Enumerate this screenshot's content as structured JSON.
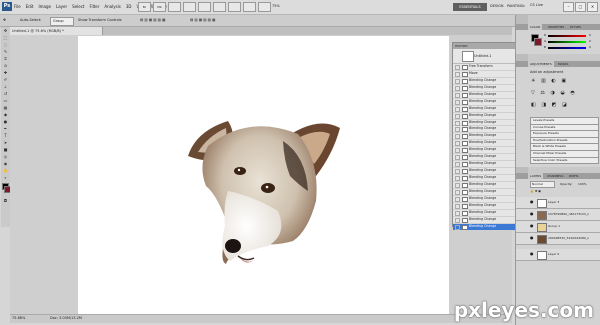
{
  "app": {
    "logo": "Ps"
  },
  "menu": [
    "File",
    "Edit",
    "Image",
    "Layer",
    "Select",
    "Filter",
    "Analysis",
    "3D",
    "View",
    "Window",
    "Help"
  ],
  "toolbar_buttons": [
    "Br",
    "Mb",
    "",
    "",
    "",
    "",
    "",
    "",
    ""
  ],
  "zoom_value": "75%",
  "workspace": {
    "active": "ESSENTIALS",
    "others": [
      "DESIGN",
      "PAINTING"
    ],
    "more": "»"
  },
  "cs_live": "CS Live",
  "window_controls": [
    "–",
    "□",
    "✕"
  ],
  "options": {
    "auto_select": "Auto-Select:",
    "auto_select_value": "Group",
    "show_transform": "Show Transform Controls"
  },
  "document": {
    "tab": "Untitled-1 @ 75.6% (RGB/8) *",
    "status_zoom": "75.68%",
    "status_doc": "Doc: 3.00M/13.2M"
  },
  "history": {
    "panel_title": "HISTORY",
    "snapshot": "Untitled-1",
    "states": [
      "Free Transform",
      "Move",
      "Blending Change",
      "Blending Change",
      "Blending Change",
      "Blending Change",
      "Blending Change",
      "Blending Change",
      "Blending Change",
      "Blending Change",
      "Blending Change",
      "Blending Change",
      "Blending Change",
      "Blending Change",
      "Blending Change",
      "Blending Change",
      "Blending Change",
      "Blending Change",
      "Blending Change",
      "Blending Change",
      "Blending Change",
      "Blending Change",
      "Blending Change",
      "Blending Change"
    ]
  },
  "color_panel": {
    "tabs": [
      "COLOR",
      "SWATCHES",
      "STYLES"
    ],
    "sliders": [
      {
        "label": "R",
        "value": "0"
      },
      {
        "label": "G",
        "value": "0"
      },
      {
        "label": "B",
        "value": "0"
      }
    ]
  },
  "adjustments": {
    "tabs": [
      "ADJUSTMENTS",
      "MASKS"
    ],
    "heading": "Add an adjustment",
    "presets": [
      "Levels Presets",
      "Curves Presets",
      "Exposure Presets",
      "Hue/Saturation Presets",
      "Black & White Presets",
      "Channel Mixer Presets",
      "Selective Color Presets"
    ]
  },
  "layers": {
    "tabs": [
      "LAYERS",
      "CHANNELS",
      "PATHS"
    ],
    "blend_mode": "Normal",
    "opacity_label": "Opacity:",
    "opacity_value": "100%",
    "items": [
      "Layer 3",
      "1078790800_n82173123_n",
      "Group 1",
      "290498532_5410044280_n",
      "Layer 0"
    ]
  },
  "watermark": "pxleyes.com",
  "colors": {
    "accent_blue": "#3c79d4",
    "workspace_dark": "#5f5f5f",
    "panel_grey": "#c9c9c9",
    "dog_tan": "#8a6a52"
  }
}
